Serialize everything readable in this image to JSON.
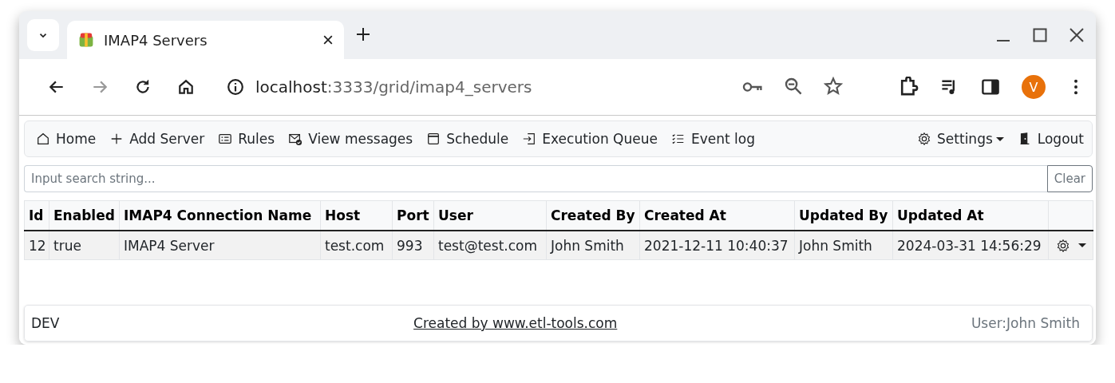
{
  "browser": {
    "tabs": [
      {
        "title": "IMAP4 Servers",
        "selected": true
      }
    ],
    "address": {
      "host": "localhost",
      "path": ":3333/grid/imap4_servers"
    },
    "profile_initial": "V"
  },
  "nav": {
    "items": [
      {
        "label": "Home",
        "kind": "home",
        "dropdown": false
      },
      {
        "label": "Add Server",
        "kind": "plus",
        "dropdown": false
      },
      {
        "label": "Rules",
        "kind": "list-card",
        "dropdown": false
      },
      {
        "label": "View messages",
        "kind": "envelope",
        "dropdown": false
      },
      {
        "label": "Schedule",
        "kind": "calendar",
        "dropdown": false
      },
      {
        "label": "Execution Queue",
        "kind": "enter",
        "dropdown": false
      },
      {
        "label": "Event log",
        "kind": "checklist",
        "dropdown": false
      }
    ],
    "right": [
      {
        "label": "Settings",
        "kind": "gear",
        "dropdown": true
      },
      {
        "label": "Logout",
        "kind": "door",
        "dropdown": false
      }
    ]
  },
  "search": {
    "placeholder": "Input search string...",
    "button": "Clear"
  },
  "table": {
    "columns": [
      "Id",
      "Enabled",
      "IMAP4 Connection Name",
      "Host",
      "Port",
      "User",
      "Created By",
      "Created At",
      "Updated By",
      "Updated At"
    ],
    "rows": [
      [
        "12",
        "true",
        "IMAP4 Server",
        "test.com",
        "993",
        "test@test.com",
        "John Smith",
        "2021-12-11 10:40:37",
        "John Smith",
        "2024-03-31 14:56:29"
      ]
    ]
  },
  "footer": {
    "left": "DEV",
    "link": "Created by www.etl-tools.com",
    "right": "User:John Smith"
  }
}
